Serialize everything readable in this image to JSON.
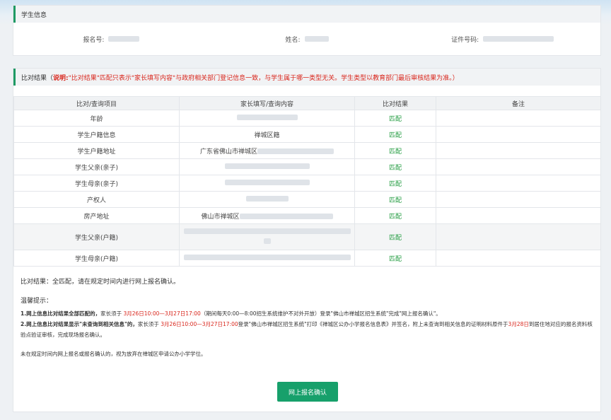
{
  "student_info": {
    "title": "学生信息",
    "registration_label": "报名号:",
    "name_label": "姓名:",
    "id_label": "证件号码:"
  },
  "compare": {
    "title": "比对结果（",
    "note_bold": "说明:",
    "note_text": "\"比对结果\"匹配只表示\"家长填写内容\"与政府相关部门登记信息一致，与学生属于哪一类型无关。学生类型以教育部门最后审核结果为准。）",
    "columns": [
      "比对/查询项目",
      "家长填写/查询内容",
      "比对结果",
      "备注"
    ],
    "rows": [
      {
        "item": "年龄",
        "content": "",
        "result": "匹配",
        "remark": ""
      },
      {
        "item": "学生户籍信息",
        "content": "禅城区籍",
        "result": "匹配",
        "remark": ""
      },
      {
        "item": "学生户籍地址",
        "content": "广东省佛山市禅城区",
        "result": "匹配",
        "remark": ""
      },
      {
        "item": "学生父亲(亲子)",
        "content": "",
        "result": "匹配",
        "remark": ""
      },
      {
        "item": "学生母亲(亲子)",
        "content": "",
        "result": "匹配",
        "remark": ""
      },
      {
        "item": "产权人",
        "content": "",
        "result": "匹配",
        "remark": ""
      },
      {
        "item": "房产地址",
        "content": "佛山市禅城区",
        "result": "匹配",
        "remark": ""
      },
      {
        "item": "学生父亲(户籍)",
        "content": "",
        "result": "匹配",
        "remark": ""
      },
      {
        "item": "学生母亲(户籍)",
        "content": "",
        "result": "匹配",
        "remark": ""
      }
    ],
    "summary": "比对结果：全匹配，请在规定时间内进行网上报名确认。",
    "tips_title": "温馨提示：",
    "tip1": {
      "bold": "1.网上信息比对结果全部匹配的，",
      "t1": "家长须于 ",
      "date": "3月26日10:00—3月27日17:00",
      "t2": "（期间每天0:00—8:00招生系统维护不对外开放）登录\"佛山市禅城区招生系统\"完成\"网上报名确认\"。"
    },
    "tip2": {
      "bold": "2.网上信息比对结果显示\"未查询到相关信息\"的，",
      "t1": "家长须于 ",
      "date": "3月26日10:00—3月27日17:00",
      "t2": "登录\"佛山市禅城区招生系统\"打印《禅城区公办小学报名信息表》并签名，附上未查询到相关信息的证明材料原件于",
      "date2": "3月28日",
      "t3": "到居住地对应的报名资料核验点验证审核，完成现场报名确认。"
    },
    "note": "未在规定时间内网上报名或报名确认的，视为放弃在禅城区申请公办小学学位。",
    "confirm_button": "网上报名确认"
  },
  "colors": {
    "accent": "#1e9a64",
    "match": "#1e9a3c",
    "warning": "#d9261c",
    "button": "#17a06b"
  }
}
